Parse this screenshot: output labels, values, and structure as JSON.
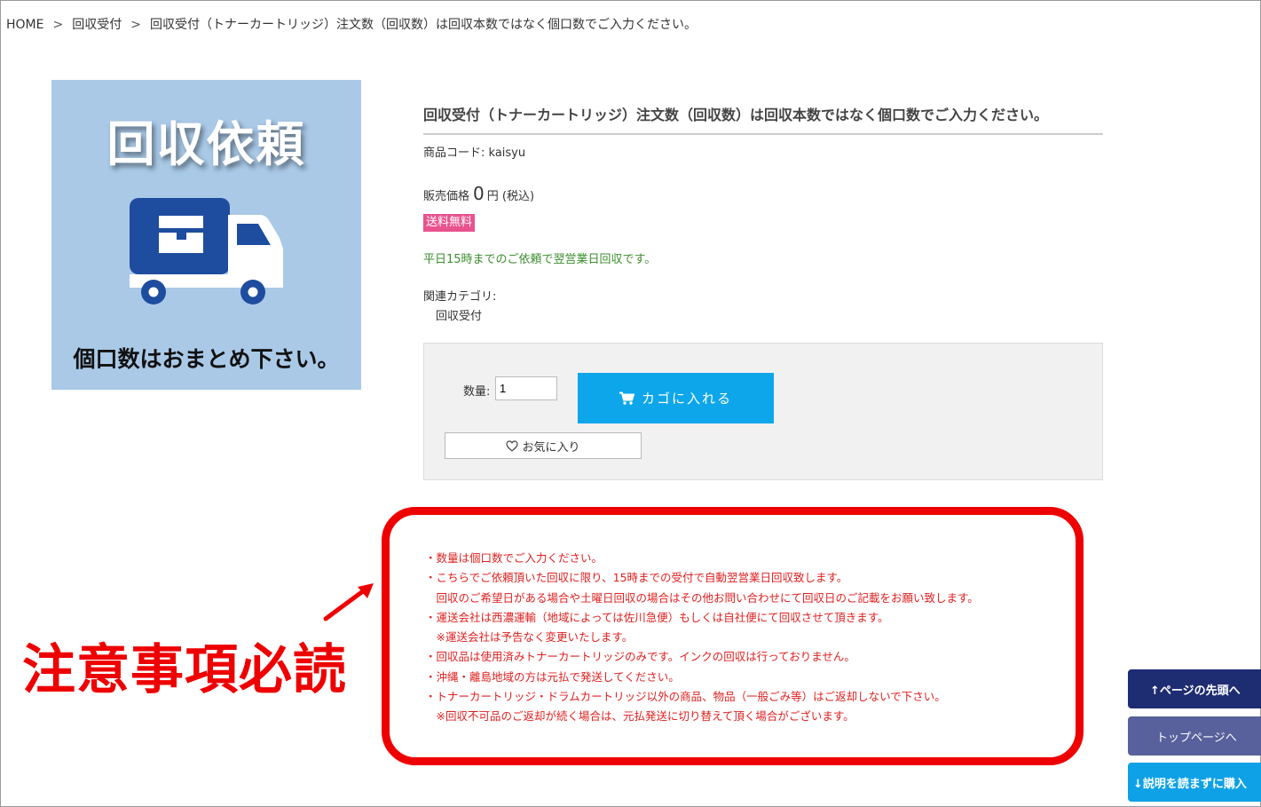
{
  "breadcrumb": {
    "items": [
      "HOME",
      "回収受付",
      "回収受付（トナーカートリッジ）注文数（回収数）は回収本数ではなく個口数でご入力ください。"
    ],
    "separator": ">"
  },
  "product_image": {
    "title": "回収依頼",
    "caption": "個口数はおまとめ下さい。",
    "icon": "delivery-truck-icon",
    "background_color": "#a9c9e7",
    "truck_color": "#1e4c9e"
  },
  "product": {
    "title": "回収受付（トナーカートリッジ）注文数（回収数）は回収本数ではなく個口数でご入力ください。",
    "code_label": "商品コード:",
    "code_value": "kaisyu",
    "price_label": "販売価格",
    "price_value": "0",
    "price_unit": "円",
    "price_tax": "(税込)",
    "badge": "送料無料",
    "badge_color": "#e8538f",
    "delivery_note": "平日15時までのご依頼で翌営業日回収です。",
    "related_label": "関連カテゴリ:",
    "related_item": "回収受付"
  },
  "cart": {
    "qty_label": "数量:",
    "qty_value": "1",
    "cart_button_label": "カゴに入れる",
    "cart_icon": "cart-icon",
    "favorite_label": "お気に入り",
    "favorite_icon": "heart-icon",
    "accent_color": "#0ea6ea"
  },
  "notice": {
    "heading": "注意事項必読",
    "lines": [
      "・数量は個口数でご入力ください。",
      "・こちらでご依頼頂いた回収に限り、15時までの受付で自動翌営業日回収致します。",
      "　回収のご希望日がある場合や土曜日回収の場合はその他お問い合わせにて回収日のご記載をお願い致します。",
      "・運送会社は西濃運輸（地域によっては佐川急便）もしくは自社便にて回収させて頂きます。",
      "　※運送会社は予告なく変更いたします。",
      "・回収品は使用済みトナーカートリッジのみです。インクの回収は行っておりません。",
      "・沖縄・離島地域の方は元払で発送してください。",
      "・トナーカートリッジ・ドラムカートリッジ以外の商品、物品（一般ごみ等）はご返却しないで下さい。",
      "　※回収不可品のご返却が続く場合は、元払発送に切り替えて頂く場合がございます。"
    ],
    "color": "#ee0000"
  },
  "side_buttons": {
    "page_top": "↑ページの先頭へ",
    "home": "トップページへ",
    "buy": "↓説明を読まずに購入"
  }
}
